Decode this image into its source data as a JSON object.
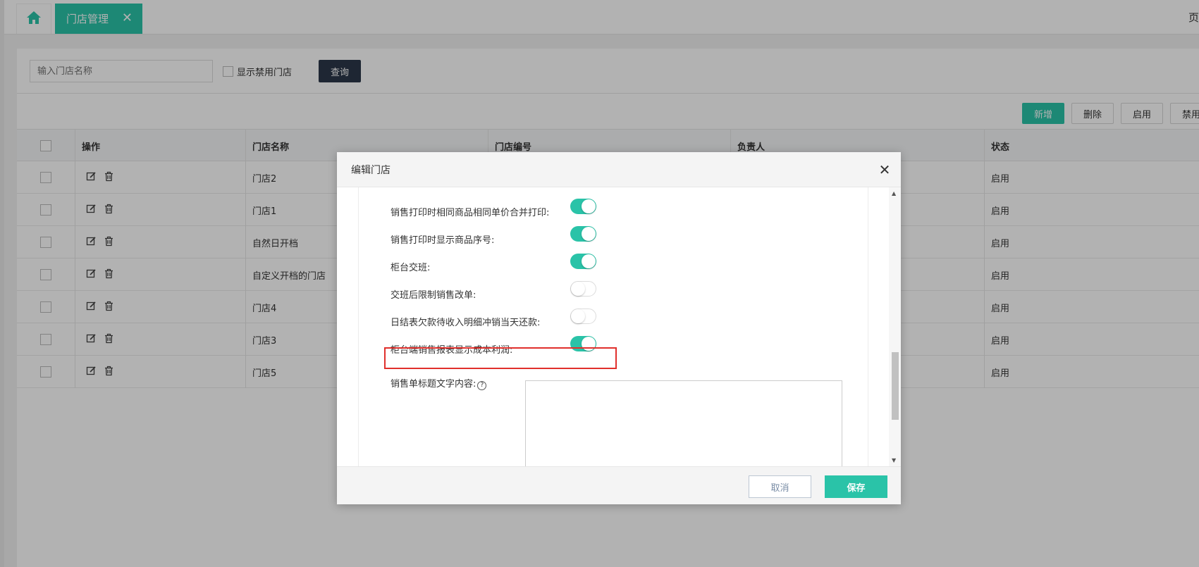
{
  "tabs": {
    "home_icon": "home-icon",
    "active_label": "门店管理",
    "close_glyph": "✕",
    "right_text": "页"
  },
  "search": {
    "placeholder": "输入门店名称",
    "show_disabled_label": "显示禁用门店",
    "query_label": "查询"
  },
  "toolbar": {
    "add_label": "新增",
    "delete_label": "删除",
    "enable_label": "启用",
    "disable_label": "禁用"
  },
  "table": {
    "headers": [
      "操作",
      "门店名称",
      "门店编号",
      "负责人",
      "状态"
    ],
    "rows": [
      {
        "name": "门店2",
        "status": "启用"
      },
      {
        "name": "门店1",
        "status": "启用"
      },
      {
        "name": "自然日开档",
        "status": "启用"
      },
      {
        "name": "自定义开档的门店",
        "status": "启用"
      },
      {
        "name": "门店4",
        "status": "启用"
      },
      {
        "name": "门店3",
        "status": "启用"
      },
      {
        "name": "门店5",
        "status": "启用"
      }
    ]
  },
  "dialog": {
    "title": "编辑门店",
    "close_glyph": "✕",
    "options": [
      {
        "label": "销售打印时相同商品相同单价合并打印:",
        "on": true
      },
      {
        "label": "销售打印时显示商品序号:",
        "on": true
      },
      {
        "label": "柜台交班:",
        "on": true
      },
      {
        "label": "交班后限制销售改单:",
        "on": false
      },
      {
        "label": "日结表欠款待收入明细冲销当天还款:",
        "on": false
      },
      {
        "label": "柜台端销售报表显示成本利润:",
        "on": true
      }
    ],
    "title_text_label": "销售单标题文字内容:",
    "help_glyph": "?",
    "cancel_label": "取消",
    "save_label": "保存"
  },
  "colors": {
    "accent": "#2ac3a8",
    "dark_button": "#2c3749",
    "highlight": "#e0302c"
  }
}
